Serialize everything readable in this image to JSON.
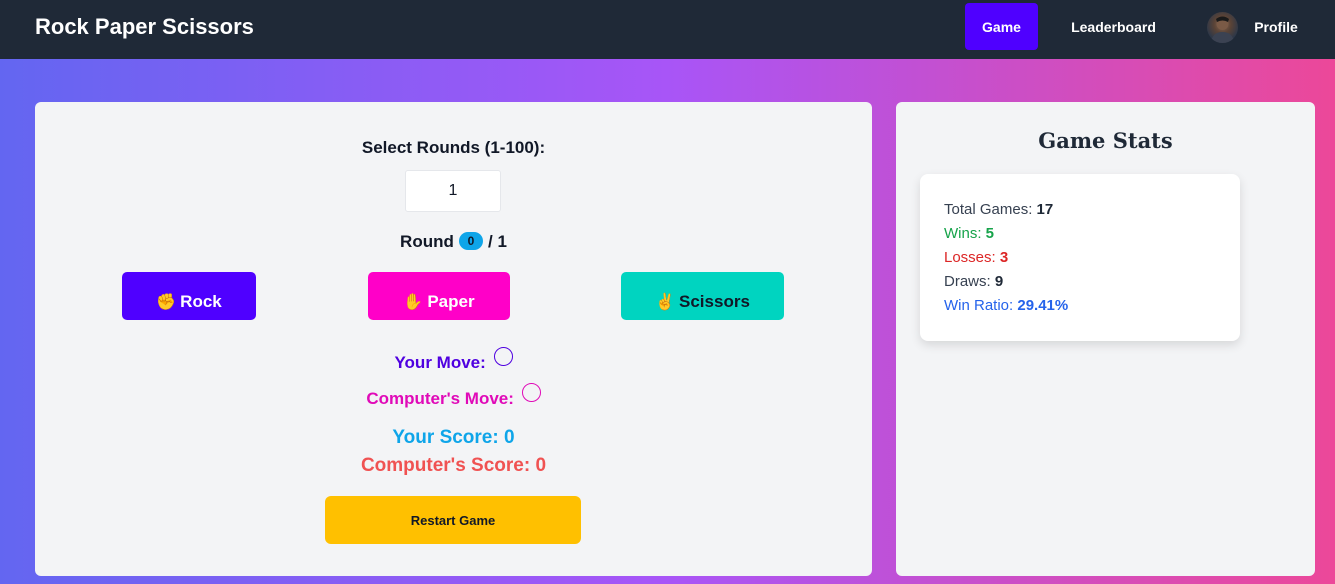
{
  "nav": {
    "brand": "Rock Paper Scissors",
    "game": "Game",
    "leaderboard": "Leaderboard",
    "profile": "Profile"
  },
  "game": {
    "select_label": "Select Rounds (1-100):",
    "rounds_value": "1",
    "round_prefix": "Round",
    "current_round": "0",
    "round_separator": "/ 1",
    "buttons": {
      "rock_emoji": "✊",
      "rock": "Rock",
      "paper_emoji": "✋",
      "paper": "Paper",
      "scissors_emoji": "✌",
      "scissors": "Scissors"
    },
    "your_move_label": "Your Move:",
    "computer_move_label": "Computer's Move:",
    "your_score": "Your Score: 0",
    "computer_score": "Computer's Score: 0",
    "restart": "Restart Game"
  },
  "stats": {
    "title": "Game Stats",
    "total_label": "Total Games:",
    "total_value": "17",
    "wins_label": "Wins:",
    "wins_value": "5",
    "losses_label": "Losses:",
    "losses_value": "3",
    "draws_label": "Draws:",
    "draws_value": "9",
    "ratio_label": "Win Ratio:",
    "ratio_value": "29.41%"
  },
  "colors": {
    "navbar": "#1f2937",
    "primary": "#4f00ff",
    "paper": "#ff00c8",
    "scissors": "#00d4c0",
    "restart": "#ffc000"
  },
  "icons": {
    "avatar": "profile-avatar",
    "your_move_indicator": "empty-circle-icon",
    "computer_move_indicator": "empty-circle-icon"
  }
}
